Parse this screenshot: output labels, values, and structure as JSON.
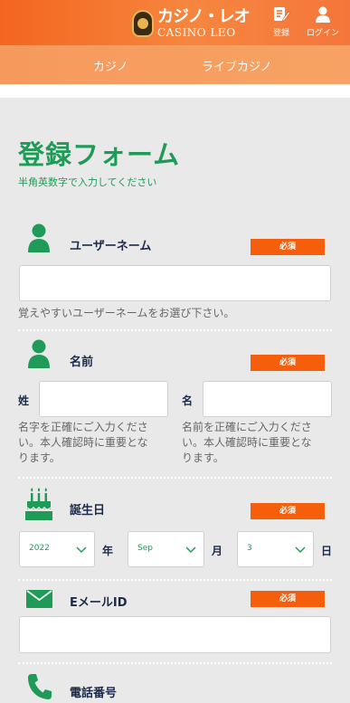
{
  "header": {
    "logo_jp": "カジノ・レオ",
    "logo_en": "CASINO LEO",
    "register_label": "登録",
    "login_label": "ログイン"
  },
  "nav": {
    "casino_label": "カジノ",
    "live_casino_label": "ライブカジノ"
  },
  "form": {
    "title": "登録フォーム",
    "subtitle": "半角英数字で入力してください",
    "required_label": "必須",
    "username": {
      "label": "ユーザーネーム",
      "value": "",
      "hint": "覚えやすいユーザーネームをお選び下さい。"
    },
    "name": {
      "label": "名前",
      "last_label": "姓",
      "first_label": "名",
      "last_value": "",
      "first_value": "",
      "last_hint_1": "名字を正確にご入力くださ",
      "last_hint_2": "い。本人確認時に重要とな",
      "last_hint_3": "ります。",
      "first_hint_1": "名前を正確にご入力くださ",
      "first_hint_2": "い。本人確認時に重要とな",
      "first_hint_3": "ります。"
    },
    "birthday": {
      "label": "誕生日",
      "year_value": "2022",
      "year_label": "年",
      "month_value": "Sep",
      "month_label": "月",
      "day_value": "3",
      "day_label": "日"
    },
    "email": {
      "label": "EメールID",
      "value": ""
    },
    "phone": {
      "label": "電話番号"
    }
  },
  "icons": {
    "user": "user-icon",
    "cake": "cake-icon",
    "mail": "mail-icon",
    "phone": "phone-icon",
    "chevron": "chevron-down-icon"
  },
  "colors": {
    "header_orange": "#f3661f",
    "green": "#1f9b57",
    "required_orange": "#f55e0a",
    "label_navy": "#1b2a4a"
  }
}
